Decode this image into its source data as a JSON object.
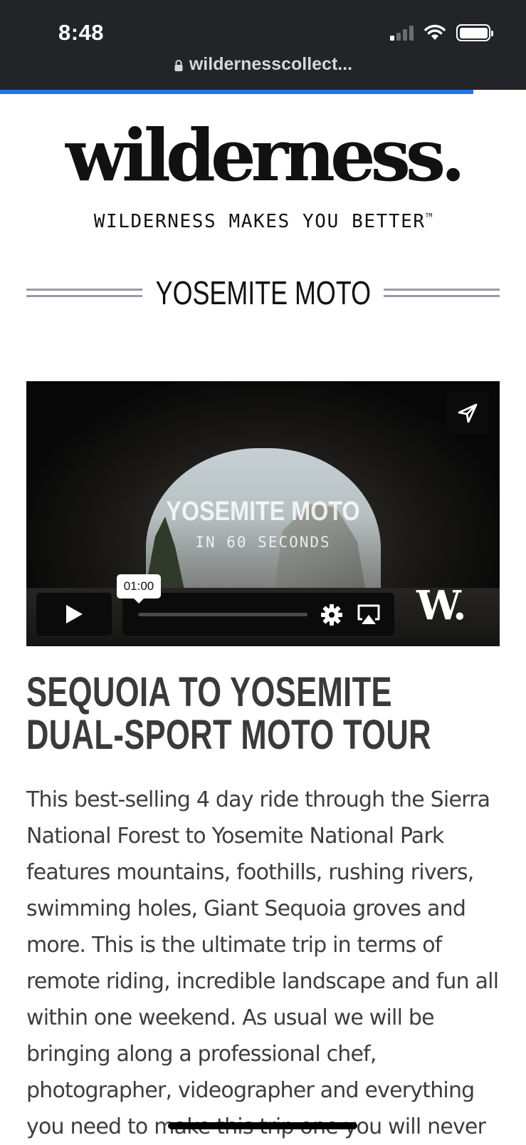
{
  "status_bar": {
    "time": "8:48",
    "icons": [
      "cellular-signal-icon",
      "wifi-icon",
      "battery-icon"
    ]
  },
  "browser": {
    "url": "wildernesscollect...",
    "lock_icon": "lock-icon",
    "load_progress": 0.9,
    "progress_color": "#1f78e0"
  },
  "header": {
    "logo": "wilderness.",
    "tagline": "WILDERNESS MAKES YOU BETTER",
    "trademark": "TM"
  },
  "page": {
    "title": "YOSEMITE MOTO"
  },
  "video": {
    "title": "YOSEMITE MOTO",
    "subtitle": "IN 60 SECONDS",
    "duration": "01:00",
    "logo": "W.",
    "controls": [
      "play-icon",
      "settings-gear-icon",
      "airplay-icon",
      "share-icon"
    ]
  },
  "article": {
    "heading": "SEQUOIA TO YOSEMITE DUAL-SPORT MOTO TOUR",
    "description": "This best-selling 4 day ride through the Sierra National Forest to Yosemite National Park features mountains, foothills, rushing rivers, swimming holes, Giant Sequoia groves and more. This is the ultimate trip in terms of remote riding, incredible landscape and fun all within one weekend. As usual we will be bringing along a professional chef, photographer, videographer and everything you need to make this trip one you will never"
  },
  "colors": {
    "chrome_background": "#232427",
    "heading_text": "#3a3a3a",
    "body_text": "#3d3d3d"
  }
}
